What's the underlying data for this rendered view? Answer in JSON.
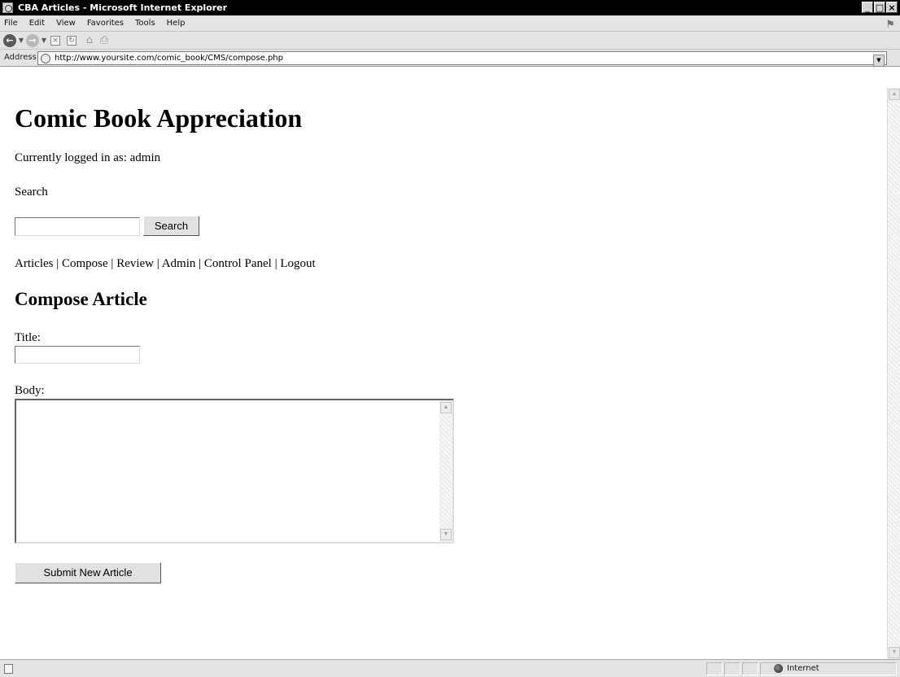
{
  "window": {
    "title": "CBA Articles - Microsoft Internet Explorer",
    "controls": {
      "minimize": "_",
      "maximize": "□",
      "close": "×"
    }
  },
  "menubar": {
    "items": [
      {
        "label": "File"
      },
      {
        "label": "Edit"
      },
      {
        "label": "View"
      },
      {
        "label": "Favorites"
      },
      {
        "label": "Tools"
      },
      {
        "label": "Help"
      }
    ]
  },
  "address": {
    "label": "Address",
    "url": "http://www.yoursite.com/comic_book/CMS/compose.php"
  },
  "page": {
    "title": "Comic Book Appreciation",
    "logged_in_text": "Currently logged in as: admin",
    "search_heading": "Search",
    "search_value": "",
    "search_button": "Search",
    "nav": [
      {
        "label": "Articles"
      },
      {
        "label": "Compose"
      },
      {
        "label": "Review"
      },
      {
        "label": "Admin"
      },
      {
        "label": "Control Panel"
      },
      {
        "label": "Logout"
      }
    ],
    "nav_separator": " | ",
    "compose_heading": "Compose Article",
    "title_label": "Title:",
    "title_value": "",
    "body_label": "Body:",
    "body_value": "",
    "submit_button": "Submit New Article"
  },
  "statusbar": {
    "zone": "Internet"
  }
}
